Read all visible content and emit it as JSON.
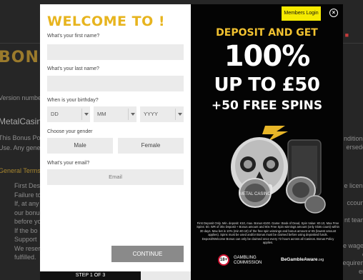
{
  "background": {
    "headline": "BONU",
    "version_text": "Version numbe",
    "brand": "MetalCasin",
    "para1": "This Bonus Poli",
    "para2": "Use. Any gener",
    "section_heading": "General Terms",
    "lines": [
      "First Des",
      "Failure to",
      "If, at any",
      "our bonuses",
      "before you",
      "If the bo",
      "Support",
      "We reser",
      "fulfilled."
    ],
    "right_lines": [
      "nditions",
      "ersede"
    ],
    "right_lower_lines": [
      "e licens",
      "",
      "ccount",
      "",
      "nt team",
      "",
      "",
      "e wager",
      "e requirem",
      "en"
    ]
  },
  "modal": {
    "title": "WELCOME TO !",
    "first_name_label": "What's your first name?",
    "last_name_label": "What's your last name?",
    "birthday_label": "When is your birthday?",
    "dd": "DD",
    "mm": "MM",
    "yyyy": "YYYY",
    "gender_label": "Choose your gender",
    "male": "Male",
    "female": "Female",
    "email_label": "What's your email?",
    "email_placeholder": "Email",
    "continue": "CONTINUE",
    "step": "STEP 1 OF 3"
  },
  "promo": {
    "members_login": "Members Login",
    "close": "×",
    "line1": "DEPOSIT AND GET",
    "line2": "100%",
    "line3": "UP TO £50",
    "line4": "+50 FREE SPINS",
    "terms": "First Deposit Only. Min. deposit: €10, max. Bonus €100. Game: Book of Dead, Spin Value: €0.10, Max Free Spins: 50. WR of 30x Deposit + Bonus amount and 60x Free Spin winnings amount (only Slots count) within 30 days. Max bet is 10% (min €0.10) of the free spin winnings and bonus amount or €5 (lowest amount applies). Spins must be used and/or Bonus must be claimed before using deposited funds. Deposit/Welcome Bonus can only be claimed once every 72 hours across all Casinos. Bonus Policy applies.",
    "age": "18+",
    "gc_line1": "GAMBLING",
    "gc_line2": "COMMISSION",
    "bga": "BeGambleAware",
    "bga_suffix": ".org",
    "coin_text": "METAL CASINO"
  },
  "colors": {
    "gold": "#e7b41e",
    "promo_gold": "#f2c230",
    "members_yellow": "#f5ea00",
    "field_grey": "#ebebeb",
    "continue_grey": "#8a8a8a"
  }
}
